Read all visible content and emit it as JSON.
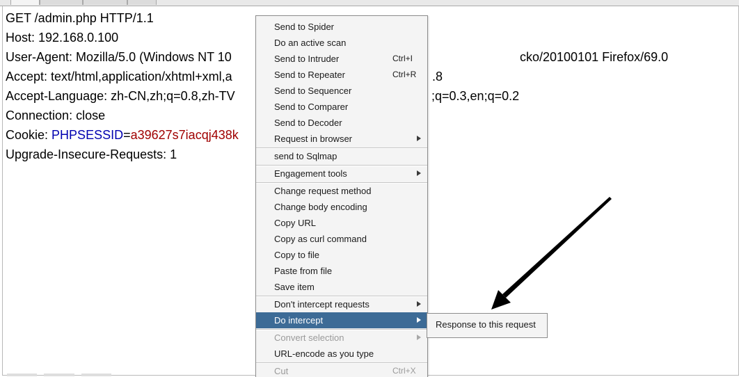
{
  "request": {
    "line1": "GET /admin.php HTTP/1.1",
    "line2": "Host: 192.168.0.100",
    "line3": "User-Agent: Mozilla/5.0 (Windows NT 10",
    "line3_tail": "cko/20100101 Firefox/69.0",
    "line4": "Accept: text/html,application/xhtml+xml,a",
    "line4_tail": ".8",
    "line5": "Accept-Language: zh-CN,zh;q=0.8,zh-TV",
    "line5_tail": ";q=0.3,en;q=0.2",
    "line6": "Connection: close",
    "cookie_prefix": "Cookie: ",
    "cookie_name": "PHPSESSID",
    "cookie_eq": "=",
    "cookie_value": "a39627s7iacqj438k",
    "line8": "Upgrade-Insecure-Requests: 1"
  },
  "menu": {
    "send_to_spider": "Send to Spider",
    "do_active_scan": "Do an active scan",
    "send_to_intruder": "Send to Intruder",
    "send_to_intruder_shortcut": "Ctrl+I",
    "send_to_repeater": "Send to Repeater",
    "send_to_repeater_shortcut": "Ctrl+R",
    "send_to_sequencer": "Send to Sequencer",
    "send_to_comparer": "Send to Comparer",
    "send_to_decoder": "Send to Decoder",
    "request_in_browser": "Request in browser",
    "send_to_sqlmap": "send to Sqlmap",
    "engagement_tools": "Engagement tools",
    "change_request_method": "Change request method",
    "change_body_encoding": "Change body encoding",
    "copy_url": "Copy URL",
    "copy_as_curl": "Copy as curl command",
    "copy_to_file": "Copy to file",
    "paste_from_file": "Paste from file",
    "save_item": "Save item",
    "dont_intercept": "Don't intercept requests",
    "do_intercept": "Do intercept",
    "convert_selection": "Convert selection",
    "url_encode": "URL-encode as you type",
    "cut": "Cut",
    "cut_shortcut": "Ctrl+X"
  },
  "submenu": {
    "response_to_request": "Response to this request"
  },
  "colors": {
    "selected_bg": "#3d6b96",
    "cookie_name": "#0000b0",
    "cookie_value": "#a00000",
    "annotation_arrow": "#000000"
  }
}
